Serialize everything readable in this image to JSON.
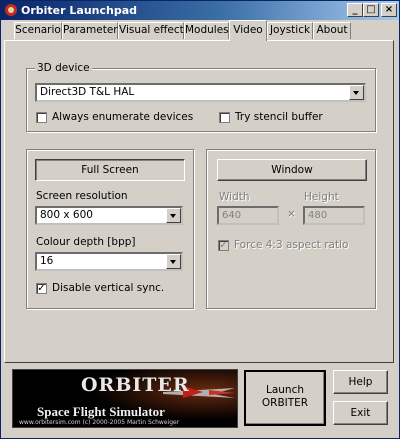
{
  "window": {
    "title": "Orbiter Launchpad",
    "controls": {
      "minimize": "_",
      "maximize": "□",
      "close": "×"
    }
  },
  "tabs": [
    {
      "label": "Scenario",
      "active": false
    },
    {
      "label": "Parameters",
      "active": false
    },
    {
      "label": "Visual effects",
      "active": false
    },
    {
      "label": "Modules",
      "active": false
    },
    {
      "label": "Video",
      "active": true
    },
    {
      "label": "Joystick",
      "active": false
    },
    {
      "label": "About",
      "active": false
    }
  ],
  "device_group": {
    "label": "3D device",
    "device": "Direct3D T&L HAL",
    "always_enumerate": {
      "label": "Always enumerate devices",
      "checked": false
    },
    "stencil": {
      "label": "Try stencil buffer",
      "checked": false
    }
  },
  "fullscreen": {
    "button": "Full Screen",
    "resolution_label": "Screen resolution",
    "resolution": "800 x 600",
    "depth_label": "Colour depth [bpp]",
    "depth": "16",
    "vsync": {
      "label": "Disable vertical sync.",
      "checked": true
    }
  },
  "windowed": {
    "button": "Window",
    "width_label": "Width",
    "height_label": "Height",
    "width": "640",
    "height": "480",
    "times": "×",
    "aspect": {
      "label": "Force 4:3 aspect ratio",
      "checked": true
    }
  },
  "logo": {
    "title": "ORBITER",
    "subtitle": "Space Flight Simulator",
    "credit": "www.orbitersim.com  (c) 2000-2005 Martin Schweiger"
  },
  "buttons": {
    "launch_line1": "Launch",
    "launch_line2": "ORBITER",
    "help": "Help",
    "exit": "Exit"
  },
  "colors": {
    "title_start": "#0a246a",
    "title_end": "#a6caf0",
    "face": "#d4d0c8"
  }
}
